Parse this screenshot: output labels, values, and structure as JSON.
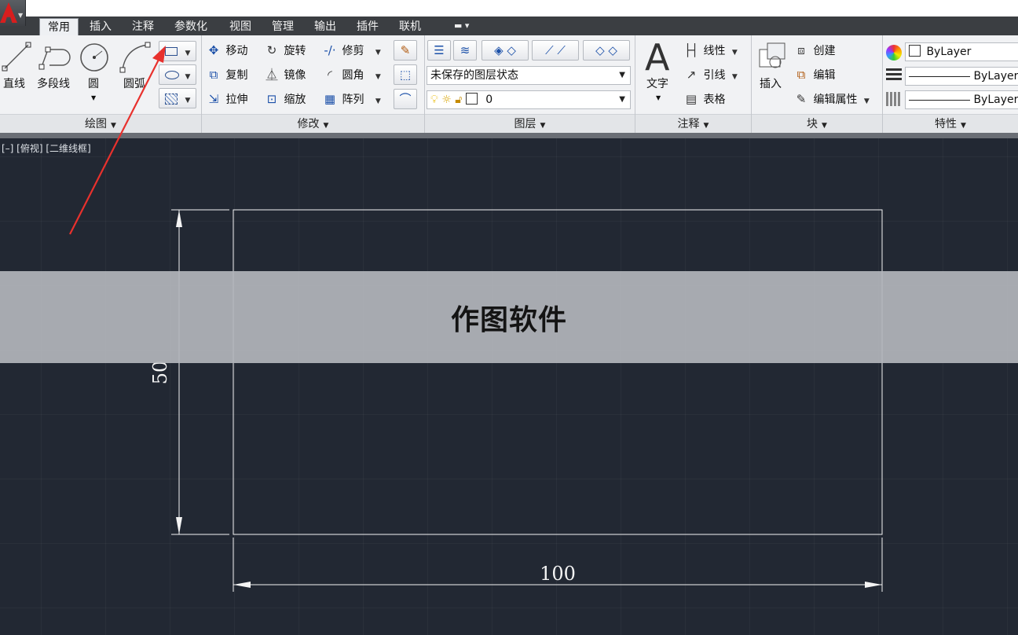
{
  "tabs": [
    "常用",
    "插入",
    "注释",
    "参数化",
    "视图",
    "管理",
    "输出",
    "插件",
    "联机"
  ],
  "draw_panel": {
    "title": "绘图",
    "line": "直线",
    "polyline": "多段线",
    "circle": "圆",
    "arc": "圆弧"
  },
  "modify_panel": {
    "title": "修改",
    "move": "移动",
    "rotate": "旋转",
    "trim": "修剪",
    "copy": "复制",
    "mirror": "镜像",
    "fillet": "圆角",
    "stretch": "拉伸",
    "scale": "缩放",
    "array": "阵列"
  },
  "layers_panel": {
    "title": "图层",
    "state": "未保存的图层状态",
    "current_layer": "0"
  },
  "annotation_panel": {
    "title": "注释",
    "text": "文字",
    "linear": "线性",
    "leader": "引线",
    "table": "表格"
  },
  "block_panel": {
    "title": "块",
    "insert": "插入",
    "create": "创建",
    "edit": "编辑",
    "edit_attributes": "编辑属性"
  },
  "properties_panel": {
    "title": "特性",
    "color": "ByLayer",
    "linetype": "ByLayer",
    "lineweight": "ByLayer"
  },
  "viewport": {
    "label": "[–] [俯视] [二维线框]",
    "dim_width": "100",
    "dim_height": "50"
  },
  "banner": {
    "text": "作图软件"
  },
  "colors": {
    "canvas": "#222833",
    "ribbon": "#f1f2f4",
    "tabbar": "#3b3e42",
    "arrow": "#e8312d",
    "acad_red": "#d81e1e"
  }
}
